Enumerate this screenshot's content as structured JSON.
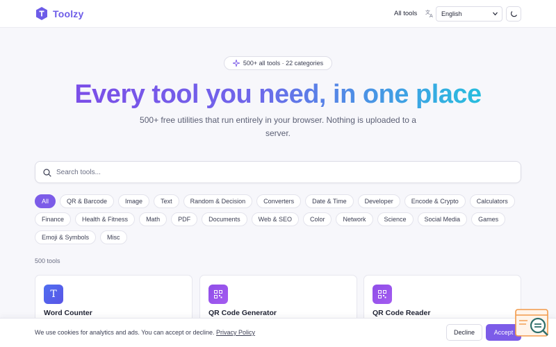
{
  "header": {
    "brand": "Toolzy",
    "nav_all_tools": "All tools",
    "language": "English",
    "theme_icon": "moon-icon",
    "translate_icon": "translate-icon"
  },
  "hero": {
    "badge": "500+ all tools · 22 categories",
    "title": "Every tool you need, in one place",
    "subtitle": "500+ free utilities that run entirely in your browser. Nothing is uploaded to a server."
  },
  "search": {
    "placeholder": "Search tools..."
  },
  "categories": {
    "row1": [
      "All",
      "QR & Barcode",
      "Image",
      "Text",
      "Random & Decision",
      "Converters",
      "Date & Time",
      "Developer",
      "Encode & Crypto",
      "Calculators"
    ],
    "row2": [
      "Finance",
      "Health & Fitness",
      "Math",
      "PDF",
      "Documents",
      "Web & SEO",
      "Color",
      "Network",
      "Science",
      "Social Media",
      "Games"
    ],
    "row3": [
      "Emoji & Symbols",
      "Misc"
    ],
    "active": "All"
  },
  "tool_count": "500 tools",
  "tools": [
    {
      "name": "Word Counter",
      "icon": "text-t-icon",
      "color": "#4f6ef0"
    },
    {
      "name": "QR Code Generator",
      "icon": "qr-code-icon",
      "color": "#8f4ee8"
    },
    {
      "name": "QR Code Reader",
      "icon": "qr-code-icon",
      "color": "#8f4ee8"
    }
  ],
  "cookie": {
    "message": "We use cookies for analytics and ads. You can accept or decline.",
    "policy_link": "Privacy Policy",
    "decline": "Decline",
    "accept": "Accept"
  },
  "colors": {
    "accent": "#7c5ce8",
    "gradient_start": "#7b4fe8",
    "gradient_end": "#22c4dc"
  }
}
